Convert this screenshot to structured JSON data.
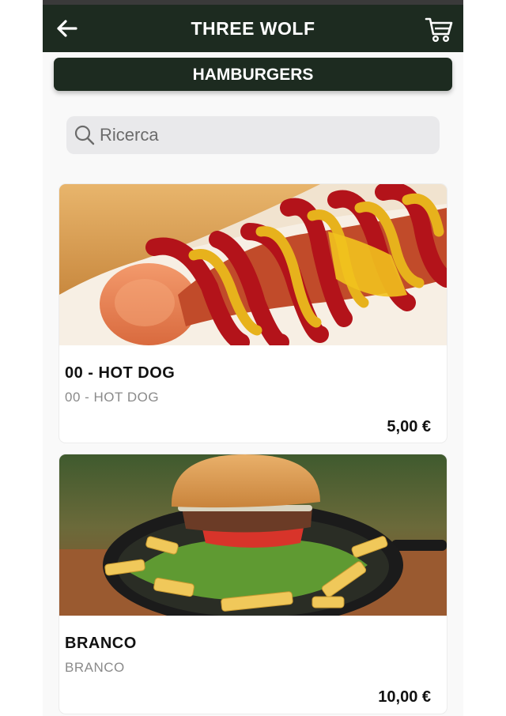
{
  "header": {
    "title": "THREE WOLF",
    "back_icon": "arrow-left-icon",
    "cart_icon": "shopping-cart-icon",
    "bar_color": "#1d2b20"
  },
  "category": {
    "label": "HAMBURGERS"
  },
  "search": {
    "placeholder": "Ricerca",
    "value": "",
    "icon": "search-icon"
  },
  "products": [
    {
      "name": "00 - HOT DOG",
      "description": "00 - HOT DOG",
      "price": "5,00 €",
      "image": "hot-dog-photo"
    },
    {
      "name": "BRANCO",
      "description": "BRANCO",
      "price": "10,00 €",
      "image": "burger-with-fries-photo"
    }
  ]
}
